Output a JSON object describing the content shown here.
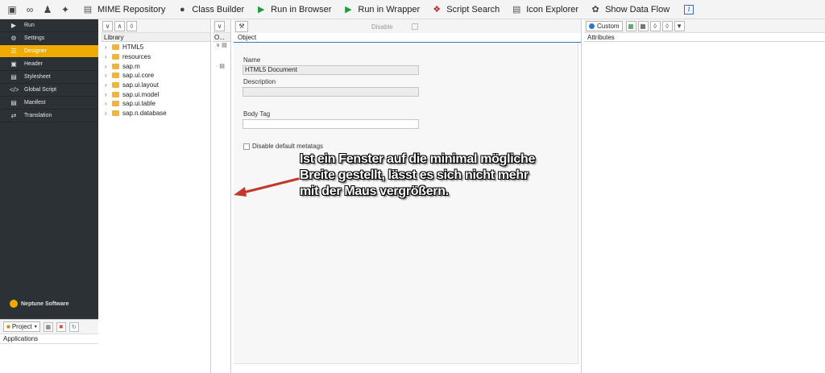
{
  "toolbar": {
    "buttons": [
      {
        "label": "MIME Repository",
        "icon": "mime-icon"
      },
      {
        "label": "Class Builder",
        "icon": "class-icon"
      },
      {
        "label": "Run in Browser",
        "icon": "run-triangle-icon"
      },
      {
        "label": "Run in Wrapper",
        "icon": "run-triangle-icon"
      },
      {
        "label": "Script Search",
        "icon": "script-search-icon"
      },
      {
        "label": "Icon Explorer",
        "icon": "icon-explorer-icon"
      },
      {
        "label": "Show Data Flow",
        "icon": "data-flow-icon"
      }
    ],
    "info_label": "i"
  },
  "nav": {
    "items": [
      {
        "label": "Run",
        "icon": "play-icon"
      },
      {
        "label": "Settings",
        "icon": "gear-icon"
      },
      {
        "label": "Designer",
        "icon": "list-icon"
      },
      {
        "label": "Header",
        "icon": "html5-icon"
      },
      {
        "label": "Stylesheet",
        "icon": "css3-icon"
      },
      {
        "label": "Global Script",
        "icon": "code-icon"
      },
      {
        "label": "Manifest",
        "icon": "document-icon"
      },
      {
        "label": "Translation",
        "icon": "shuffle-icon"
      }
    ],
    "active_index": 2,
    "brand": "Neptune Software"
  },
  "project": {
    "button_label": "Project",
    "list_header": "Applications"
  },
  "library": {
    "header": "Library",
    "items": [
      "HTML5",
      "resources",
      "sap.m",
      "sap.ui.core",
      "sap.ui.layout",
      "sap.ui.model",
      "sap.ui.table",
      "sap.n.database"
    ]
  },
  "outline": {
    "header": "O..."
  },
  "object": {
    "header": "Object",
    "disable_label": "Disable",
    "name_label": "Name",
    "name_value": "HTML5 Document",
    "description_label": "Description",
    "description_value": "",
    "body_tag_label": "Body Tag",
    "body_tag_value": "",
    "metatags_label": "Disable default metatags"
  },
  "attributes": {
    "custom_label": "Custom",
    "header": "Attributes"
  },
  "annotation": {
    "text": "Ist ein Fenster auf die minimal mögliche\nBreite gestellt, lässt es sich nicht mehr\nmit der Maus vergrößern.",
    "arrow_color": "#c0392b"
  },
  "colors": {
    "nav_bg": "#2c3135",
    "nav_active": "#f0ab00",
    "accent_blue": "#2b7bc7",
    "folder": "#f2b43a"
  }
}
